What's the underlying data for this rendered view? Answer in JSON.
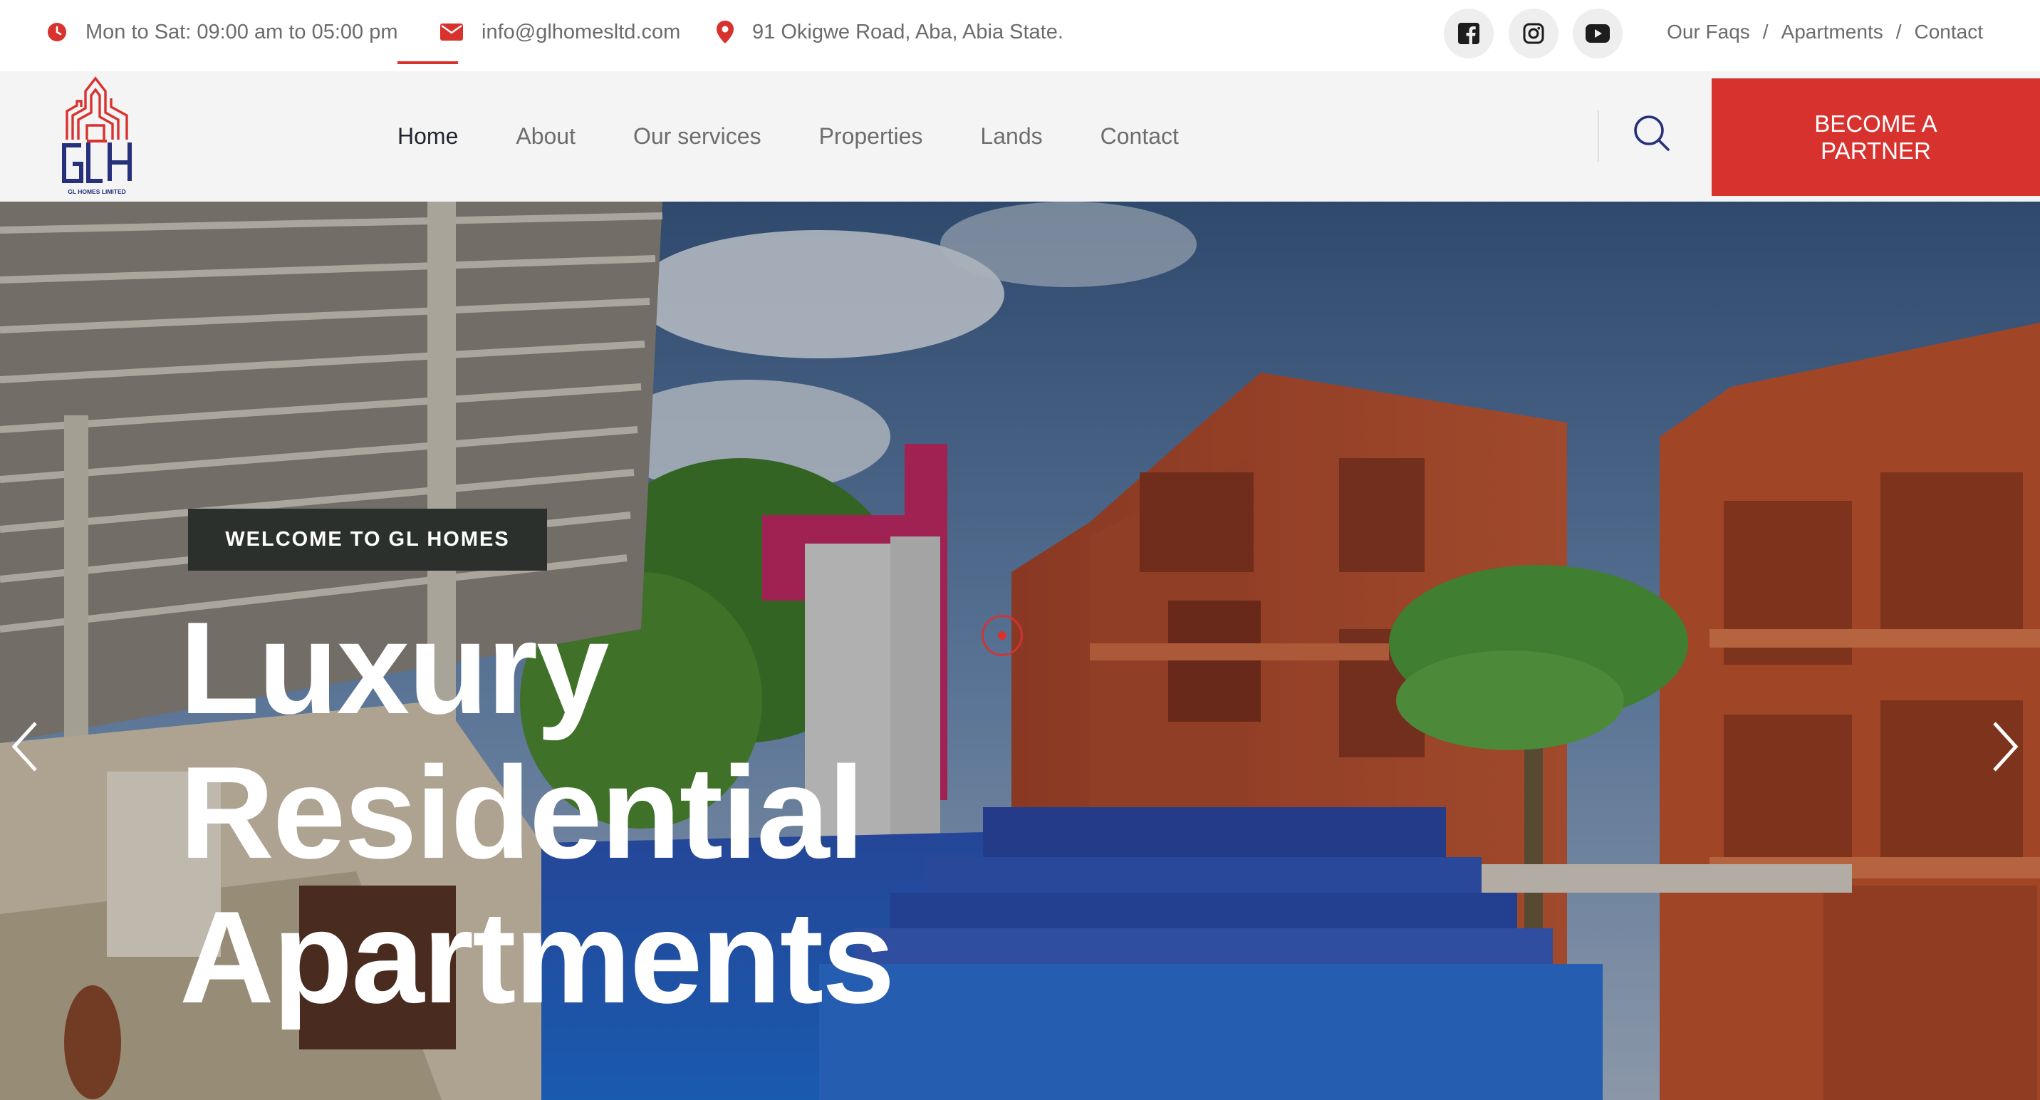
{
  "topbar": {
    "hours": "Mon to Sat: 09:00 am to 05:00 pm",
    "email": "info@glhomesltd.com",
    "address": "91 Okigwe Road, Aba, Abia State.",
    "social": [
      {
        "icon": "facebook-icon"
      },
      {
        "icon": "instagram-icon"
      },
      {
        "icon": "youtube-icon"
      }
    ],
    "links": [
      "Our Faqs",
      "Apartments",
      "Contact"
    ],
    "link_separator": "/"
  },
  "logo": {
    "text": "GLH",
    "caption": "GL HOMES LIMITED"
  },
  "nav": {
    "items": [
      "Home",
      "About",
      "Our services",
      "Properties",
      "Lands",
      "Contact"
    ],
    "active": "Home"
  },
  "partner_button": {
    "label": "BECOME A PARTNER"
  },
  "hero": {
    "tag": "WELCOME TO GL HOMES",
    "title_lines": [
      "Luxury",
      "Residential",
      "Apartments"
    ]
  },
  "colors": {
    "accent": "#d8322f",
    "navy": "#27307a",
    "tag_bg": "#2b302c"
  }
}
